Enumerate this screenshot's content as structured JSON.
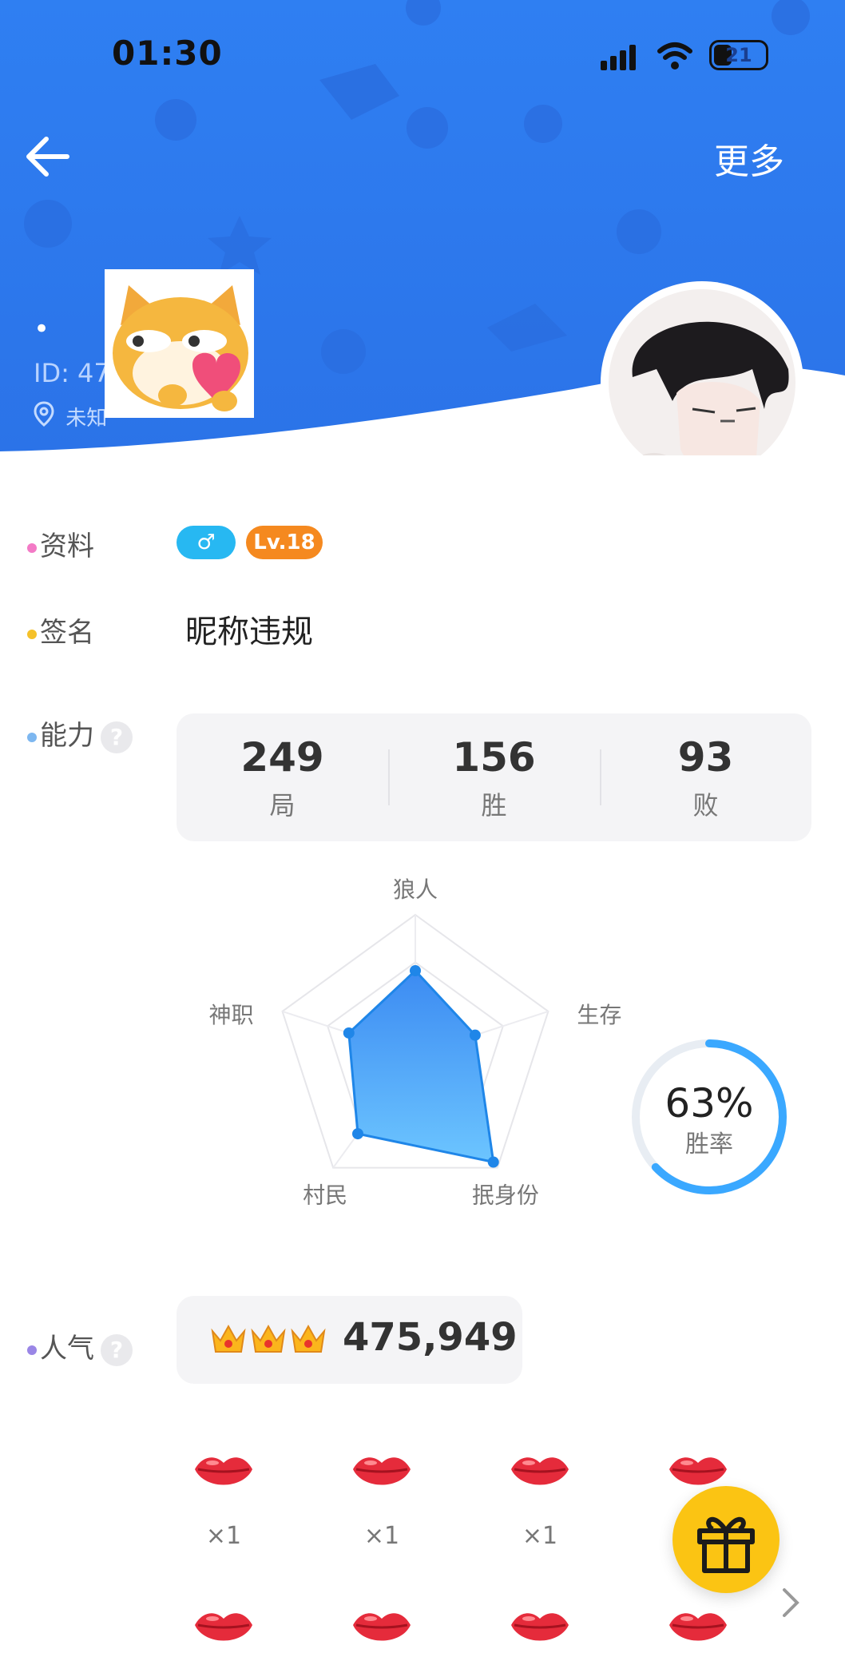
{
  "status_bar": {
    "time": "01:30",
    "battery": "21"
  },
  "header": {
    "back_icon": "arrow-left-icon",
    "more_label": "更多"
  },
  "profile": {
    "name_dot": "•",
    "id_text": "ID: 47",
    "location_text": "未知",
    "gender_symbol": "♂",
    "level": "Lv.18"
  },
  "labels": {
    "profile": "资料",
    "signature": "签名",
    "ability": "能力",
    "popularity": "人气"
  },
  "signature_text": "昵称违规",
  "stats": [
    {
      "value": "249",
      "label": "局"
    },
    {
      "value": "156",
      "label": "胜"
    },
    {
      "value": "93",
      "label": "败"
    }
  ],
  "win_rate": {
    "value": "63%",
    "label": "胜率",
    "fraction": 0.63
  },
  "radar": {
    "axes": [
      "狼人",
      "生存",
      "抿身份",
      "村民",
      "神职"
    ],
    "values": [
      0.6,
      0.45,
      0.95,
      0.7,
      0.5
    ]
  },
  "popularity": {
    "value": "475,949",
    "crowns": 3
  },
  "gifts": {
    "row1": [
      {
        "count": "×1"
      },
      {
        "count": "×1"
      },
      {
        "count": "×1"
      },
      {
        "count": ""
      }
    ],
    "row2_count": 4
  },
  "colors": {
    "header_blue": "#2f7ff2",
    "accent_blue": "#3aa8ff",
    "level_orange": "#f5891f",
    "gift_yellow": "#fbc413"
  }
}
